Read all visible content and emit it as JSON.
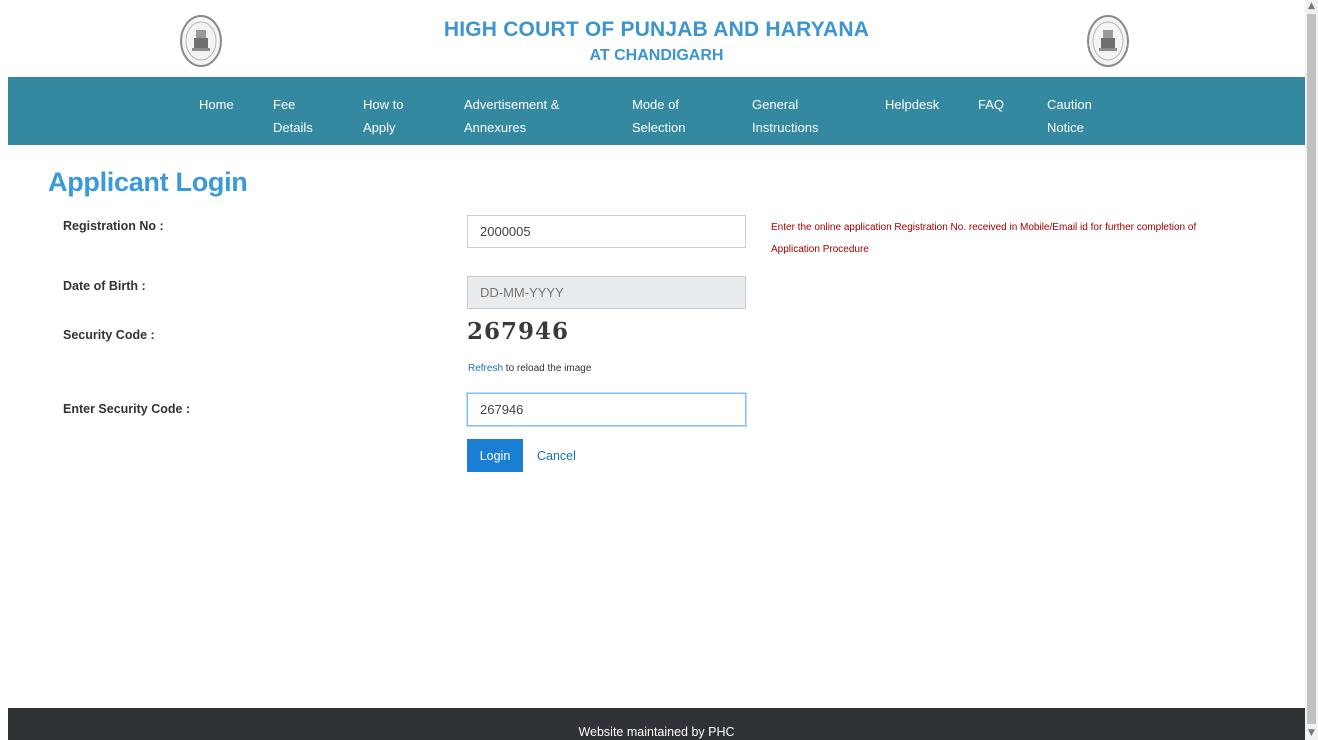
{
  "header": {
    "title_line1": "HIGH COURT OF PUNJAB AND HARYANA",
    "title_line2": "AT CHANDIGARH"
  },
  "nav": {
    "items": [
      {
        "line1": "Home",
        "line2": ""
      },
      {
        "line1": "Fee",
        "line2": "Details"
      },
      {
        "line1": "How to",
        "line2": "Apply"
      },
      {
        "line1": "Advertisement &",
        "line2": "Annexures"
      },
      {
        "line1": "Mode of",
        "line2": "Selection"
      },
      {
        "line1": "General",
        "line2": "Instructions"
      },
      {
        "line1": "Helpdesk",
        "line2": ""
      },
      {
        "line1": "FAQ",
        "line2": ""
      },
      {
        "line1": "Caution",
        "line2": "Notice"
      }
    ]
  },
  "login": {
    "title": "Applicant Login",
    "registration_label": "Registration No :",
    "registration_value": "2000005",
    "registration_hint_line1": "Enter the online application Registration No. received in Mobile/Email id for further completion of",
    "registration_hint_line2": "Application Procedure",
    "dob_label": "Date of Birth :",
    "dob_placeholder": "DD-MM-YYYY",
    "security_label": "Security Code :",
    "captcha_text": "267946",
    "refresh_link": "Refresh",
    "refresh_suffix": " to reload the image",
    "enter_security_label": "Enter Security Code :",
    "enter_security_value": "267946",
    "login_button": "Login",
    "cancel_link": "Cancel"
  },
  "footer": {
    "text": "Website maintained by PHC"
  },
  "icons": {
    "emblem": "court-emblem-icon",
    "scroll_up": "chevron-up-icon",
    "scroll_down": "chevron-down-icon"
  }
}
